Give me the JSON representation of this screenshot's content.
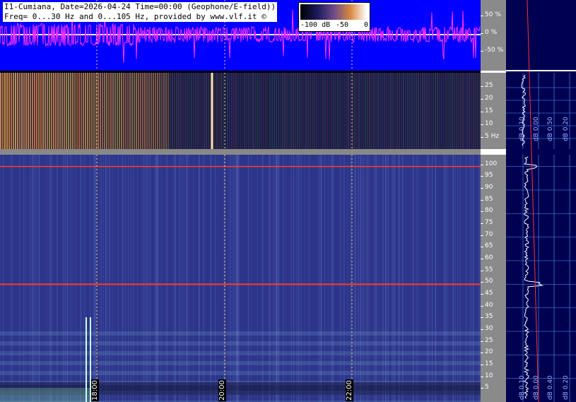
{
  "header": {
    "line1": "I1-Cumiana, Date=2026-04-24 Time=00:00 (Geophone/E-field))",
    "line2": "Freq= 0...30 Hz and 0...105 Hz, provided by www.vlf.it ©"
  },
  "colorbar": {
    "label_min": "-100 dB",
    "label_mid": "-50",
    "label_max": "0"
  },
  "wave_axis": [
    "50 %",
    "0 %",
    "-50 %"
  ],
  "spec1_axis": [
    "25",
    "20",
    "15",
    "10",
    "5 Hz"
  ],
  "spec2_axis": [
    "100",
    "95",
    "90",
    "85",
    "80",
    "75",
    "70",
    "65",
    "60",
    "55",
    "50",
    "45",
    "40",
    "35",
    "30",
    "25",
    "20",
    "15",
    "10",
    "5"
  ],
  "time_labels": [
    "18:00",
    "20:00",
    "22:00"
  ],
  "right_panel": {
    "top_labels": [
      "dB 0.10",
      "dB 0.00",
      "dB 0.50",
      "dB 0.20"
    ],
    "bottom_labels": [
      "dB 0.10",
      "dB 0.00",
      "dB 0.40",
      "dB 0.20"
    ]
  },
  "colors": {
    "wave_bg": "#0000ff",
    "waveform": "#ff33ff",
    "spec_bg": "#2c358a",
    "hum_line": "#ff3a2a"
  }
}
